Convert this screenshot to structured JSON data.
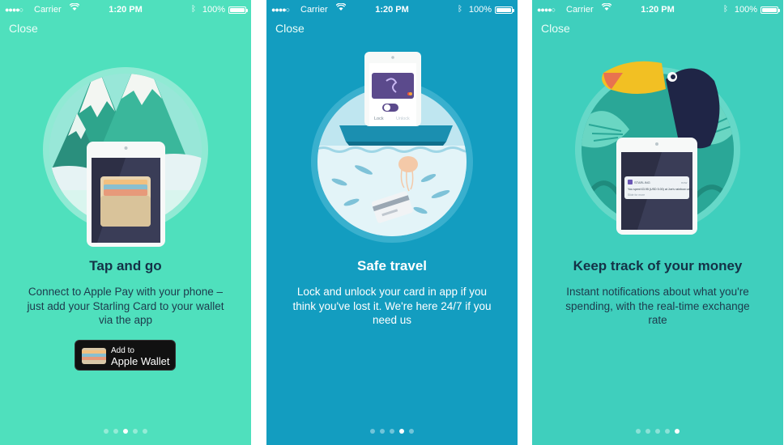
{
  "screens": [
    {
      "status": {
        "signal": "●●●●○",
        "carrier": "Carrier",
        "time": "1:20 PM",
        "battery": "100%"
      },
      "close_label": "Close",
      "title": "Tap and go",
      "body": "Connect to Apple Pay with your phone – just add your Starling Card to your wallet via the app",
      "wallet_button": {
        "line1": "Add to",
        "line2": "Apple Wallet"
      },
      "pages": 5,
      "active_page": 3
    },
    {
      "status": {
        "signal": "●●●●○",
        "carrier": "Carrier",
        "time": "1:20 PM",
        "battery": "100%"
      },
      "close_label": "Close",
      "title": "Safe travel",
      "body": "Lock and unlock your card in app if you think you've lost it. We're here 24/7 if you need us",
      "toggle": {
        "lock": "Lock",
        "unlock": "Unlock"
      },
      "pages": 5,
      "active_page": 4
    },
    {
      "status": {
        "signal": "●●●●○",
        "carrier": "Carrier",
        "time": "1:20 PM",
        "battery": "100%"
      },
      "close_label": "Close",
      "title": "Keep track of your money",
      "body": "Instant notifications about what you're spending, with the real-time exchange rate",
      "notification": {
        "app": "STARLING",
        "time": "now",
        "text": "You spent £3.95 (USD 5.00) at Joe's rainbow cafe",
        "sub": "Slide for more"
      },
      "pages": 5,
      "active_page": 5
    }
  ],
  "colors": {
    "screen1_bg": "#4fe0bd",
    "screen2_bg": "#139dc0",
    "screen3_bg": "#3fcfbd",
    "dark_text": "#143247"
  },
  "icons": [
    "signal-dots-icon",
    "wifi-icon",
    "bluetooth-icon",
    "battery-icon",
    "wallet-icon"
  ]
}
